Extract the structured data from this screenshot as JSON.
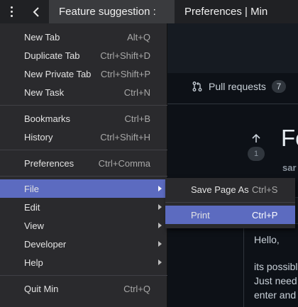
{
  "tabs": {
    "active_title": "Feature suggestion :",
    "inactive_title": "Preferences | Min"
  },
  "page": {
    "pull_requests_label": "Pull requests",
    "pull_requests_count": "7",
    "upvote_count": "1",
    "title_fragment": "Fe",
    "author_fragment": "sar",
    "comment_lines": [
      "Hello,",
      "its possibl",
      "Just need",
      "enter and"
    ]
  },
  "menu": {
    "items": [
      {
        "label": "New Tab",
        "shortcut": "Alt+Q"
      },
      {
        "label": "Duplicate Tab",
        "shortcut": "Ctrl+Shift+D"
      },
      {
        "label": "New Private Tab",
        "shortcut": "Ctrl+Shift+P"
      },
      {
        "label": "New Task",
        "shortcut": "Ctrl+N"
      },
      {
        "label": "Bookmarks",
        "shortcut": "Ctrl+B"
      },
      {
        "label": "History",
        "shortcut": "Ctrl+Shift+H"
      },
      {
        "label": "Preferences",
        "shortcut": "Ctrl+Comma"
      },
      {
        "label": "File"
      },
      {
        "label": "Edit"
      },
      {
        "label": "View"
      },
      {
        "label": "Developer"
      },
      {
        "label": "Help"
      },
      {
        "label": "Quit Min",
        "shortcut": "Ctrl+Q"
      }
    ]
  },
  "submenu": {
    "items": [
      {
        "label": "Save Page As",
        "shortcut": "Ctrl+S"
      },
      {
        "label": "Print",
        "shortcut": "Ctrl+P"
      }
    ]
  },
  "colors": {
    "highlight": "#5c6bc0",
    "menu_bg": "#2a2a2d",
    "page_bg": "#0d1117"
  }
}
